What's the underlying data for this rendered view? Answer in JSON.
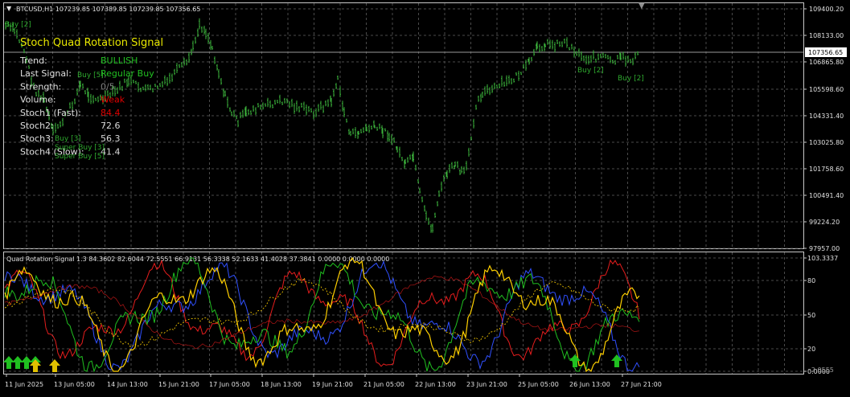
{
  "symbol_header": "BTCUSD,H1  107239.85 107389.85 107239.85 107356.65",
  "price_axis": {
    "ticks": [
      "109400.20",
      "108133.00",
      "106865.80",
      "105598.60",
      "104331.40",
      "103025.80",
      "101758.60",
      "100491.40",
      "99224.20",
      "97957.00"
    ],
    "current_price": "107356.65"
  },
  "panel": {
    "title": "Stoch Quad Rotation Signal",
    "rows": [
      {
        "label": "Trend:",
        "value": "BULLISH",
        "color": "#22c022"
      },
      {
        "label": "Last Signal:",
        "value": "Regular Buy",
        "color": "#22c022"
      },
      {
        "label": "Strength:",
        "value": "0/5",
        "color": "#808080"
      },
      {
        "label": "Volume:",
        "value": "Weak",
        "color": "#e00000"
      },
      {
        "label": "Stoch1 (Fast):",
        "value": "84.4",
        "color": "#e00000"
      },
      {
        "label": "Stoch2:",
        "value": "72.6",
        "color": "#d8d8d8"
      },
      {
        "label": "Stoch3:",
        "value": "56.3",
        "color": "#d8d8d8"
      },
      {
        "label": "Stoch4 (Slow):",
        "value": "41.4",
        "color": "#d8d8d8"
      }
    ]
  },
  "signal_labels": [
    "Buy [2]",
    "Buy [5]",
    "Buy [3]",
    "Super Buy [3]",
    "Super Buy [5]",
    "Buy [2]",
    "Buy [2]"
  ],
  "indicator": {
    "header": "Quad Rotation Signal 1.3 84.3602 82.6044 72.5551 66.9131 56.3338 52.1633 41.4028 37.3841 0.0000 0.0000 0.0000",
    "ticks": [
      "103.3337",
      "80",
      "50",
      "20",
      "0.0000"
    ],
    "ticks_faded": [
      "-2.0555"
    ]
  },
  "time_axis": [
    "11 Jun 2025",
    "13 Jun 05:00",
    "14 Jun 13:00",
    "15 Jun 21:00",
    "17 Jun 05:00",
    "18 Jun 13:00",
    "19 Jun 21:00",
    "21 Jun 05:00",
    "22 Jun 13:00",
    "23 Jun 21:00",
    "25 Jun 05:00",
    "26 Jun 13:00",
    "27 Jun 21:00"
  ],
  "colors": {
    "background": "#000000",
    "grid": "#4a4a4a",
    "candles": "#3cb43c",
    "stoch_fast": "#ff2020",
    "stoch_2": "#ffd000",
    "stoch_3": "#3050ff",
    "stoch_4": "#20c020",
    "buy_arrow": "#20c020",
    "super_buy_arrow": "#e0c000",
    "panel_title": "#e8e800",
    "panel_label": "#e0e0e0"
  }
}
